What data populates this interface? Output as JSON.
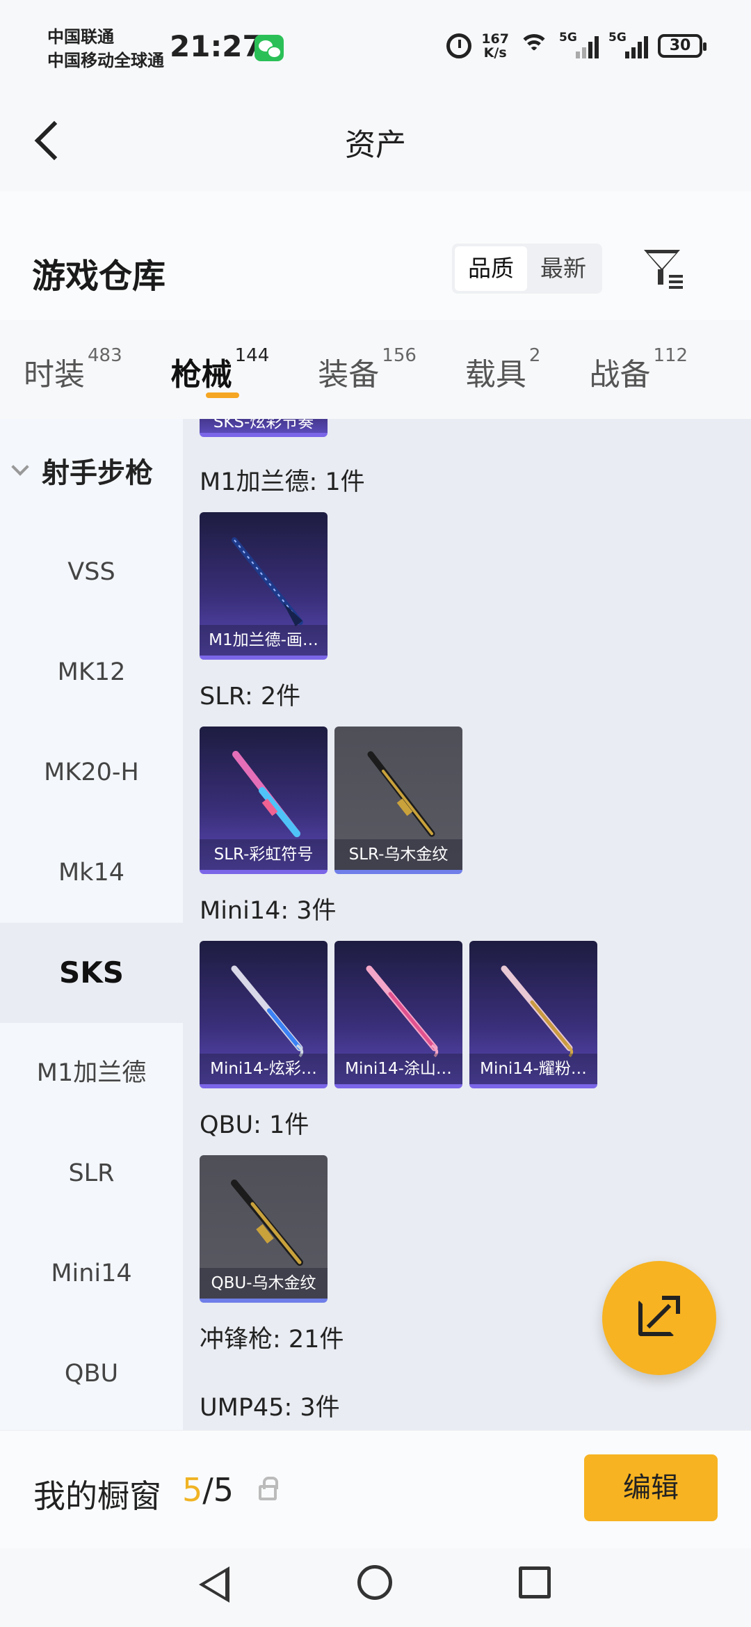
{
  "status_bar": {
    "carrier_1": "中国联通",
    "carrier_2": "中国移动全球通",
    "time": "21:27",
    "net_speed_value": "167",
    "net_speed_unit": "K/s",
    "signal_1_label": "5G",
    "signal_2_label": "5G",
    "battery": "30"
  },
  "header": {
    "title": "资产"
  },
  "warehouse": {
    "title": "游戏仓库",
    "sort_options": [
      "品质",
      "最新"
    ],
    "sort_selected": "品质"
  },
  "tabs": [
    {
      "label": "时装",
      "count": "483"
    },
    {
      "label": "枪械",
      "count": "144",
      "active": true
    },
    {
      "label": "装备",
      "count": "156"
    },
    {
      "label": "载具",
      "count": "2"
    },
    {
      "label": "战备",
      "count": "112"
    }
  ],
  "sidebar": {
    "category": "射手步枪",
    "items": [
      "VSS",
      "MK12",
      "MK20-H",
      "Mk14",
      "SKS",
      "M1加兰德",
      "SLR",
      "Mini14",
      "QBU"
    ],
    "active": "SKS"
  },
  "content": {
    "partial_card": "SKS-炫彩节奏",
    "groups": [
      {
        "label": "M1加兰德: 1件",
        "items": [
          {
            "name": "M1加兰德-画…",
            "style": "purple"
          }
        ]
      },
      {
        "label": "SLR: 2件",
        "items": [
          {
            "name": "SLR-彩虹符号",
            "style": "purple"
          },
          {
            "name": "SLR-乌木金纹",
            "style": "grey"
          }
        ]
      },
      {
        "label": "Mini14: 3件",
        "items": [
          {
            "name": "Mini14-炫彩…",
            "style": "purple"
          },
          {
            "name": "Mini14-涂山…",
            "style": "purple"
          },
          {
            "name": "Mini14-耀粉…",
            "style": "purple"
          }
        ]
      },
      {
        "label": "QBU: 1件",
        "items": [
          {
            "name": "QBU-乌木金纹",
            "style": "grey"
          }
        ]
      }
    ],
    "next_section": "冲锋枪: 21件",
    "next_group": "UMP45: 3件"
  },
  "showcase": {
    "title": "我的橱窗",
    "current": "5",
    "separator_total": "/5",
    "edit_label": "编辑"
  },
  "colors": {
    "accent": "#f7b321",
    "tab_underline": "#f5a623",
    "card_purple_border": "#7b66e8"
  }
}
